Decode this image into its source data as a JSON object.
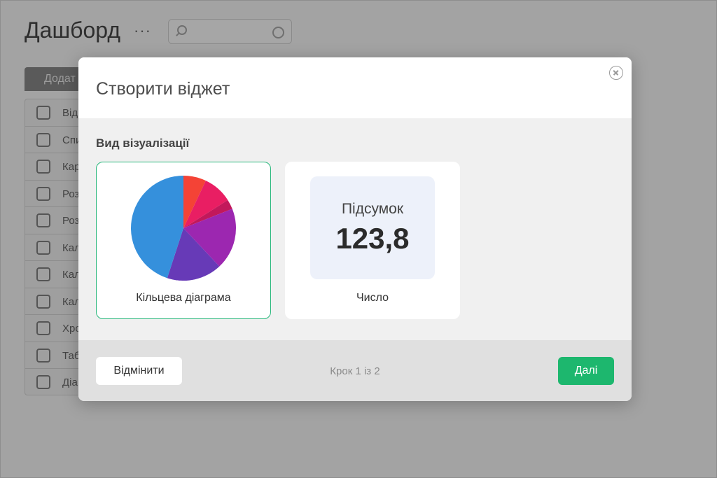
{
  "background": {
    "title": "Дашборд",
    "more_label": "···",
    "add_button_label": "Додат",
    "list_items": [
      {
        "label": "Від",
        "icon": "bar-chart-icon"
      },
      {
        "label": "Спи",
        "icon": "list-icon"
      },
      {
        "label": "Кар",
        "icon": "grid-icon"
      },
      {
        "label": "Роз",
        "icon": "schedule-clock-icon"
      },
      {
        "label": "Роз",
        "icon": "schedule-check-icon"
      },
      {
        "label": "Кал",
        "icon": "calendar-icon"
      },
      {
        "label": "Кал",
        "icon": "calendar-clock-icon"
      },
      {
        "label": "Кал",
        "icon": "calendar-check-icon"
      },
      {
        "label": "Хро",
        "icon": "timeline-icon"
      },
      {
        "label": "Таб",
        "icon": "table-icon"
      },
      {
        "label": "Діа",
        "icon": "diagram-icon"
      }
    ]
  },
  "modal": {
    "title": "Створити віджет",
    "section_label": "Вид візуалізації",
    "options": [
      {
        "label": "Кільцева діаграма",
        "selected": true
      },
      {
        "label": "Число",
        "selected": false
      }
    ],
    "number_preview": {
      "caption": "Підсумок",
      "value": "123,8"
    },
    "footer": {
      "cancel_label": "Відмінити",
      "step_text": "Крок 1 із 2",
      "next_label": "Далі"
    }
  },
  "colors": {
    "accent": "#1db76e",
    "selected_border": "#28b77b",
    "pie_slices": [
      "#f44336",
      "#e91e63",
      "#c2185b",
      "#9c27b0",
      "#673ab7",
      "#3590dc"
    ]
  },
  "chart_data": {
    "type": "pie",
    "values": [
      7,
      9,
      3,
      19,
      17,
      45
    ]
  }
}
